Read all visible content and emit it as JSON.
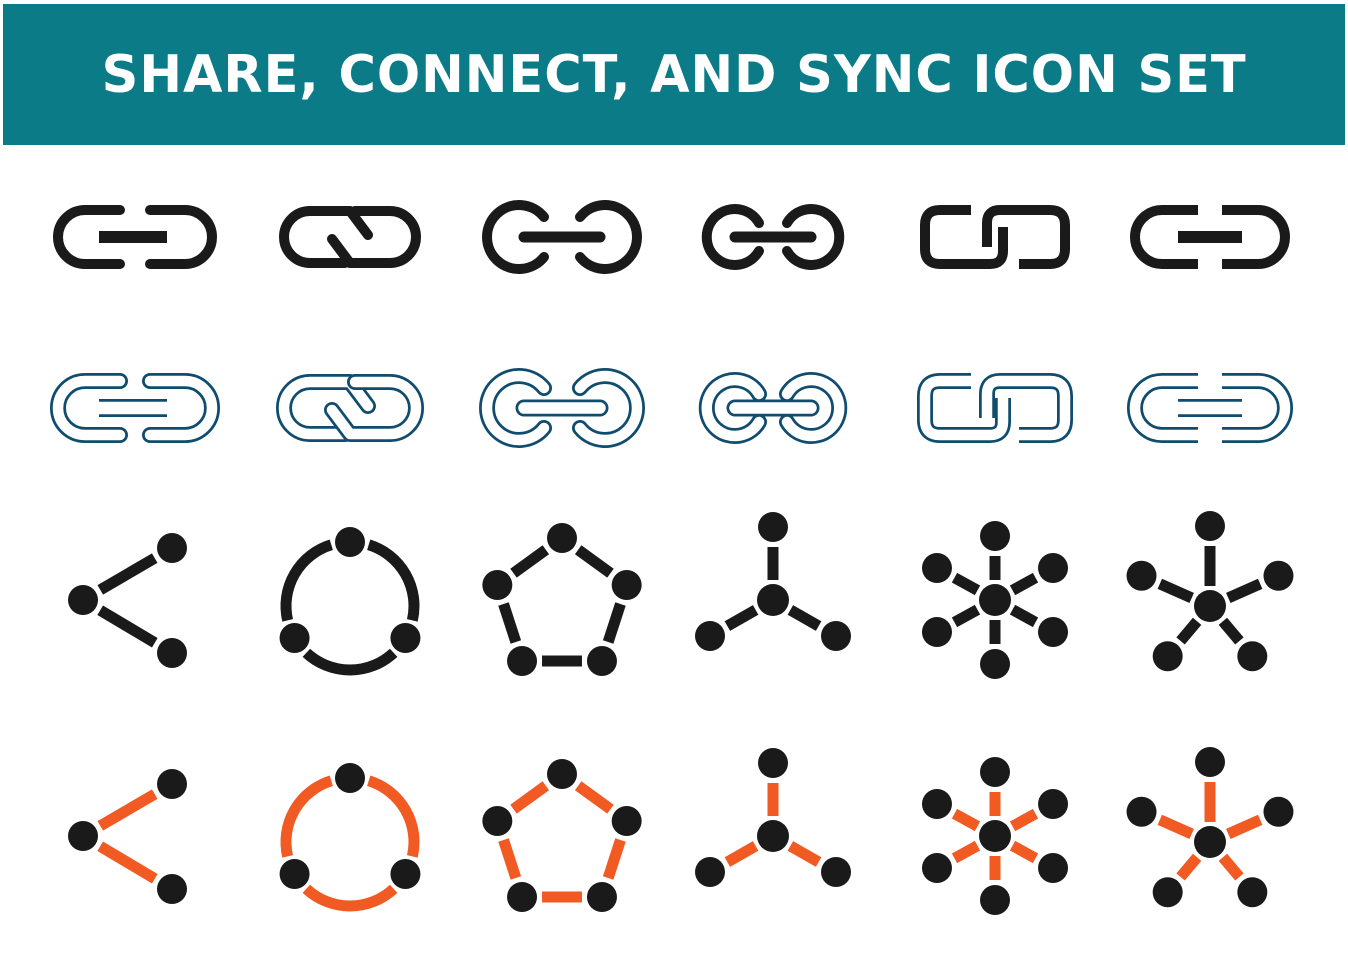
{
  "banner": {
    "title": "SHARE, CONNECT, AND SYNC ICON SET",
    "background_color": "#0b7c87",
    "text_color": "#ffffff"
  },
  "colors": {
    "solid_black": "#1a1a1a",
    "outline_blue": "#0f4c6e",
    "accent_orange": "#f15a22",
    "node_black": "#1a1a1a",
    "background": "#ffffff"
  },
  "rows": [
    {
      "name": "solid-link-icons",
      "style": "solid",
      "icons": [
        "link-bar-icon",
        "link-twisted-icon",
        "link-round-bar-icon",
        "link-circle-bar-icon",
        "link-square-interlock-icon",
        "link-square-bar-icon"
      ]
    },
    {
      "name": "outline-link-icons",
      "style": "outline",
      "icons": [
        "link-bar-outline-icon",
        "link-twisted-outline-icon",
        "link-round-bar-outline-icon",
        "link-circle-bar-outline-icon",
        "link-square-interlock-outline-icon",
        "link-square-bar-outline-icon"
      ]
    },
    {
      "name": "black-network-icons",
      "style": "black",
      "icons": [
        "share-icon",
        "three-node-cycle-icon",
        "pentagon-network-icon",
        "three-branch-hub-icon",
        "six-branch-hub-icon",
        "five-branch-hub-icon"
      ]
    },
    {
      "name": "orange-network-icons",
      "style": "orange",
      "icons": [
        "share-icon",
        "three-node-cycle-icon",
        "pentagon-network-icon",
        "three-branch-hub-icon",
        "six-branch-hub-icon",
        "five-branch-hub-icon"
      ]
    }
  ]
}
